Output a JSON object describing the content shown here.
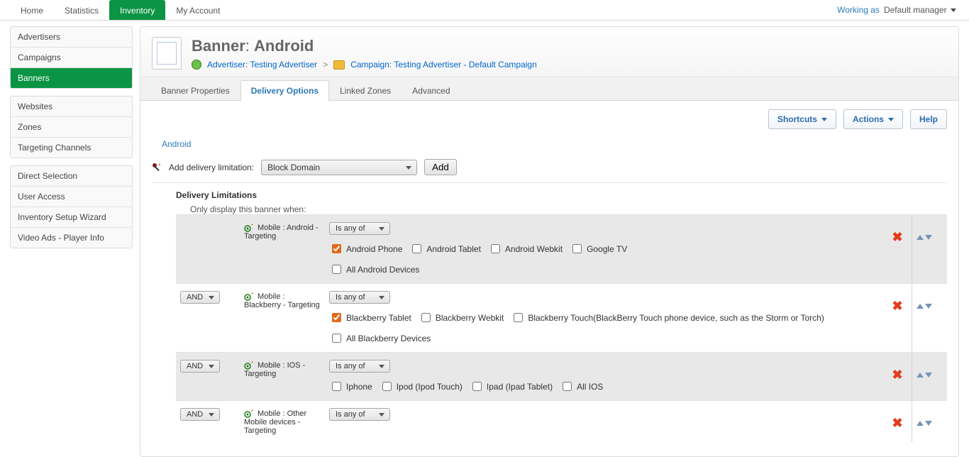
{
  "topTabs": [
    "Home",
    "Statistics",
    "Inventory",
    "My Account"
  ],
  "topActiveIndex": 2,
  "topRight": {
    "workingAs": "Working as",
    "manager": "Default manager"
  },
  "sidebar": {
    "groups": [
      {
        "items": [
          "Advertisers",
          "Campaigns",
          "Banners"
        ],
        "activeIndex": 2
      },
      {
        "items": [
          "Websites",
          "Zones",
          "Targeting Channels"
        ],
        "activeIndex": -1
      },
      {
        "items": [
          "Direct Selection",
          "User Access",
          "Inventory Setup Wizard",
          "Video Ads - Player Info"
        ],
        "activeIndex": -1
      }
    ]
  },
  "header": {
    "titlePrefix": "Banner",
    "titleName": "Android",
    "crumbAdvertiser": "Advertiser: Testing Advertiser",
    "crumbCampaign": "Campaign: Testing Advertiser - Default Campaign"
  },
  "subtabs": [
    "Banner Properties",
    "Delivery Options",
    "Linked Zones",
    "Advanced"
  ],
  "subtabActiveIndex": 1,
  "toolbar": {
    "shortcuts": "Shortcuts",
    "actions": "Actions",
    "help": "Help"
  },
  "content": {
    "bannerLink": "Android",
    "addLimitLabel": "Add delivery limitation:",
    "limitSelect": "Block Domain",
    "addBtn": "Add",
    "sectionTitle": "Delivery Limitations",
    "onlyDisplay": "Only display this banner when:",
    "opAnd": "AND",
    "opIsAnyOf": "Is any of",
    "rules": [
      {
        "alt": true,
        "showAnd": false,
        "label": "Mobile : Android - Targeting",
        "options": [
          {
            "label": "Android Phone",
            "checked": true
          },
          {
            "label": "Android Tablet",
            "checked": false
          },
          {
            "label": "Android Webkit",
            "checked": false
          },
          {
            "label": "Google TV",
            "checked": false
          }
        ],
        "options2": [
          {
            "label": "All Android Devices",
            "checked": false
          }
        ]
      },
      {
        "alt": false,
        "showAnd": true,
        "label": "Mobile : Blackberry - Targeting",
        "options": [
          {
            "label": "Blackberry Tablet",
            "checked": true
          },
          {
            "label": "Blackberry Webkit",
            "checked": false
          },
          {
            "label": "Blackberry Touch(BlackBerry Touch phone device, such as the Storm or Torch)",
            "checked": false
          },
          {
            "label": "All Blackberry Devices",
            "checked": false
          }
        ]
      },
      {
        "alt": true,
        "showAnd": true,
        "label": "Mobile : IOS - Targeting",
        "options": [
          {
            "label": "Iphone",
            "checked": false
          },
          {
            "label": "Ipod (Ipod Touch)",
            "checked": false
          },
          {
            "label": "Ipad (Ipad Tablet)",
            "checked": false
          },
          {
            "label": "All IOS",
            "checked": false
          }
        ]
      },
      {
        "alt": false,
        "showAnd": true,
        "label": "Mobile : Other Mobile devices - Targeting",
        "options": []
      }
    ]
  }
}
